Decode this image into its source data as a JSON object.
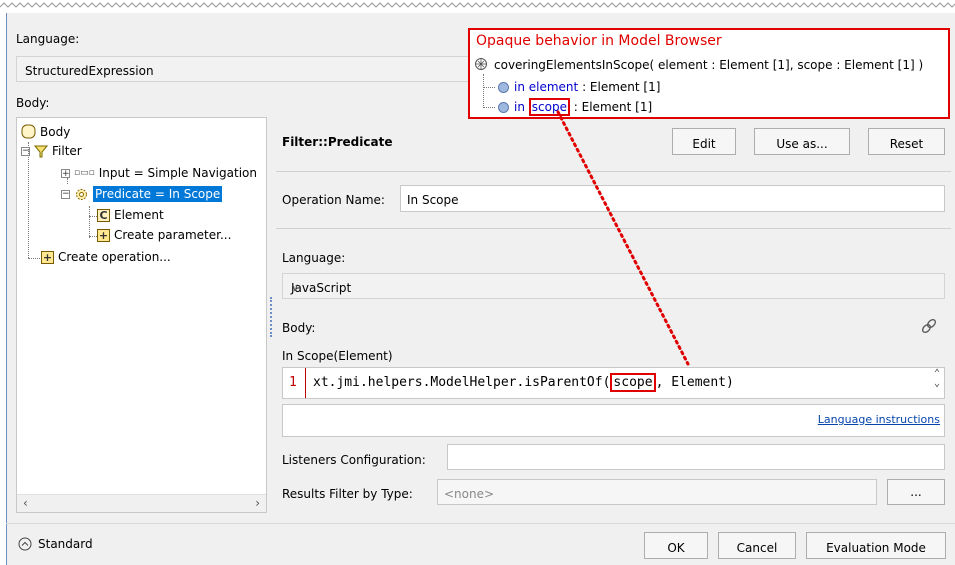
{
  "top_section": {
    "language_label": "Language:",
    "language_value": "StructuredExpression",
    "body_label": "Body:"
  },
  "tree": {
    "items": [
      {
        "label": "Body"
      },
      {
        "label": "Filter"
      },
      {
        "label": "Input = Simple Navigation"
      },
      {
        "label": "Predicate = In Scope"
      },
      {
        "label": "Element"
      },
      {
        "label": "Create parameter..."
      },
      {
        "label": "Create operation..."
      }
    ]
  },
  "right_panel": {
    "title": "Filter::Predicate",
    "edit_label": "Edit",
    "use_as_label": "Use as...",
    "reset_label": "Reset",
    "operation_name_label": "Operation Name:",
    "operation_name_value": "In Scope",
    "language_label": "Language:",
    "language_value": "JavaScript",
    "body_label": "Body:",
    "signature": "In Scope(Element)",
    "line_number": "1",
    "code_prefix": "xt.jmi.helpers.ModelHelper.isParentOf(",
    "code_param": "scope",
    "code_suffix": ", Element)",
    "language_instructions": "Language instructions",
    "listeners_label": "Listeners Configuration:",
    "results_filter_label": "Results Filter by Type:",
    "results_filter_value": "<none>",
    "more_label": "..."
  },
  "annotation": {
    "title": "Opaque behavior in Model Browser",
    "operation": "coveringElementsInScope( element : Element [1], scope : Element [1] )",
    "param1_prefix": "in element",
    "param1_suffix": " : Element [1]",
    "param2_in": "in ",
    "param2_name": "scope",
    "param2_suffix": " : Element [1]"
  },
  "bottom": {
    "standard_label": "Standard",
    "ok_label": "OK",
    "cancel_label": "Cancel",
    "evaluation_mode_label": "Evaluation Mode"
  },
  "colors": {
    "annotation_red": "#e00000",
    "selection_blue": "#0078d7",
    "link_blue": "#0645ad"
  }
}
